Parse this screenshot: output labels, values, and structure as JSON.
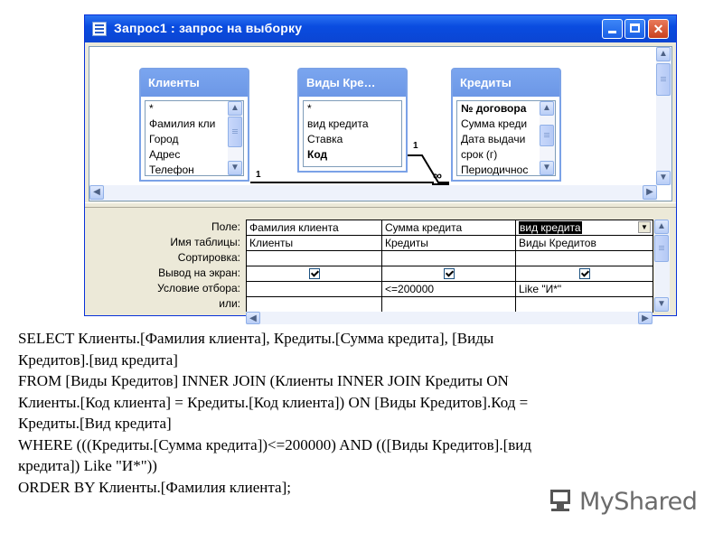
{
  "window": {
    "title": "Запрос1 : запрос на выборку",
    "min_label": "",
    "max_label": "",
    "close_label": "✕"
  },
  "tables": [
    {
      "title": "Клиенты",
      "fields": [
        {
          "label": "*",
          "bold": false
        },
        {
          "label": "Фамилия кли",
          "bold": false
        },
        {
          "label": "Город",
          "bold": false
        },
        {
          "label": "Адрес",
          "bold": false
        },
        {
          "label": "Телефон",
          "bold": false
        }
      ]
    },
    {
      "title": "Виды Кре…",
      "fields": [
        {
          "label": "*",
          "bold": false
        },
        {
          "label": "вид кредита",
          "bold": false
        },
        {
          "label": "Ставка",
          "bold": false
        },
        {
          "label": "Код",
          "bold": true
        }
      ]
    },
    {
      "title": "Кредиты",
      "fields": [
        {
          "label": "№ договора",
          "bold": true
        },
        {
          "label": "Сумма креди",
          "bold": false
        },
        {
          "label": "Дата выдачи",
          "bold": false
        },
        {
          "label": "срок (г)",
          "bold": false
        },
        {
          "label": "Периодичнос",
          "bold": false
        }
      ]
    }
  ],
  "relations": {
    "one_label_a": "1",
    "one_label_b": "1",
    "many_label": "∞"
  },
  "grid": {
    "row_labels": [
      "Поле:",
      "Имя таблицы:",
      "Сортировка:",
      "Вывод на экран:",
      "Условие отбора:",
      "или:"
    ],
    "columns": [
      {
        "field": "Фамилия клиента",
        "table": "Клиенты",
        "sort": "",
        "show": true,
        "criteria": "",
        "or": ""
      },
      {
        "field": "Сумма кредита",
        "table": "Кредиты",
        "sort": "",
        "show": true,
        "criteria": "<=200000",
        "or": ""
      },
      {
        "field": "вид кредита",
        "table": "Виды Кредитов",
        "sort": "",
        "show": true,
        "criteria": "Like \"И*\"",
        "or": ""
      }
    ]
  },
  "sql_lines": [
    "SELECT Клиенты.[Фамилия клиента], Кредиты.[Сумма кредита], [Виды",
    "Кредитов].[вид кредита]",
    "FROM [Виды Кредитов] INNER JOIN (Клиенты INNER JOIN Кредиты ON",
    "Клиенты.[Код клиента] = Кредиты.[Код клиента]) ON [Виды Кредитов].Код =",
    "Кредиты.[Вид кредита]",
    "WHERE (((Кредиты.[Сумма кредита])<=200000) AND (([Виды Кредитов].[вид",
    "кредита]) Like \"И*\"))",
    "ORDER BY Клиенты.[Фамилия клиента];"
  ],
  "logo": {
    "text": "MyShared",
    "icon": "monitor-icon"
  }
}
